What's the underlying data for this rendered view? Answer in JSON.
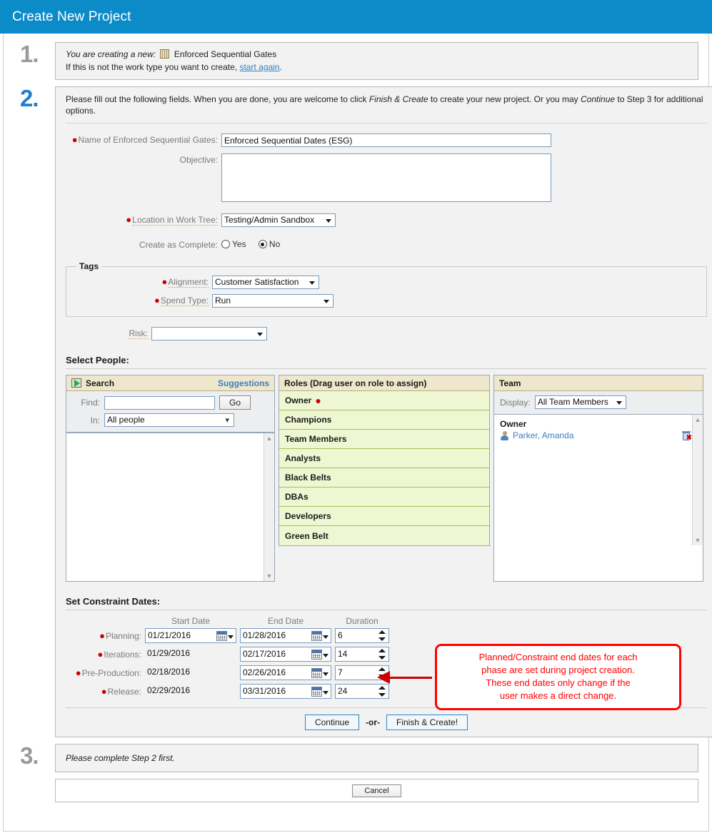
{
  "window": {
    "title": "Create New Project"
  },
  "step1": {
    "number": "1.",
    "lead": "You are creating a new:",
    "work_type": "Enforced Sequential Gates",
    "work_type_icon": "gates-icon",
    "line2_prefix": "If this is not the work type you want to create,",
    "restart_link": "start again",
    "line2_suffix": "."
  },
  "step2": {
    "number": "2.",
    "intro_part1": "Please fill out the following fields. When you are done, you are welcome to click ",
    "intro_em1": "Finish & Create",
    "intro_part2": " to create your new project. Or you may ",
    "intro_em2": "Continue",
    "intro_part3": " to Step 3 for additional options.",
    "fields": {
      "name_label": "Name of Enforced Sequential Gates:",
      "name_value": "Enforced Sequential Dates (ESG)",
      "objective_label": "Objective:",
      "objective_value": "",
      "location_label": "Location in Work Tree:",
      "location_value": "Testing/Admin Sandbox",
      "complete_label": "Create as Complete:",
      "complete_yes": "Yes",
      "complete_no": "No",
      "complete_selected": "No"
    },
    "tags": {
      "legend": "Tags",
      "alignment_label": "Alignment:",
      "alignment_value": "Customer Satisfaction",
      "spend_label": "Spend Type:",
      "spend_value": "Run"
    },
    "risk_label": "Risk:",
    "risk_value": "",
    "people": {
      "heading": "Select People:",
      "search": {
        "title": "Search",
        "icon": "search-icon",
        "suggestions_link": "Suggestions",
        "find_label": "Find:",
        "find_value": "",
        "go_label": "Go",
        "in_label": "In:",
        "in_value": "All people"
      },
      "roles": {
        "title": "Roles (Drag user on role to assign)",
        "items": [
          {
            "label": "Owner",
            "required": true
          },
          {
            "label": "Champions",
            "required": false
          },
          {
            "label": "Team Members",
            "required": false
          },
          {
            "label": "Analysts",
            "required": false
          },
          {
            "label": "Black Belts",
            "required": false
          },
          {
            "label": "DBAs",
            "required": false
          },
          {
            "label": "Developers",
            "required": false
          },
          {
            "label": "Green Belt",
            "required": false
          }
        ]
      },
      "team": {
        "title": "Team",
        "display_label": "Display:",
        "display_value": "All Team Members",
        "group_label": "Owner",
        "member_name": "Parker, Amanda",
        "member_avatar": "user-avatar-icon",
        "remove_icon": "trash-delete-icon"
      }
    },
    "dates": {
      "heading": "Set Constraint Dates:",
      "columns": [
        "Start Date",
        "End Date",
        "Duration"
      ],
      "rows": [
        {
          "label": "Planning:",
          "start": "01/21/2016",
          "start_editable": true,
          "end": "01/28/2016",
          "duration": "6"
        },
        {
          "label": "Iterations:",
          "start": "01/29/2016",
          "start_editable": false,
          "end": "02/17/2016",
          "duration": "14"
        },
        {
          "label": "Pre-Production:",
          "start": "02/18/2016",
          "start_editable": false,
          "end": "02/26/2016",
          "duration": "7"
        },
        {
          "label": "Release:",
          "start": "02/29/2016",
          "start_editable": false,
          "end": "03/31/2016",
          "duration": "24"
        }
      ]
    },
    "callout": {
      "line1": "Planned/Constraint end dates for each",
      "line2": "phase are set during project creation.",
      "line3": "These end dates only change if the",
      "line4": "user makes a direct change."
    },
    "actions": {
      "continue_label": "Continue",
      "or_label": "-or-",
      "finish_label": "Finish & Create!"
    }
  },
  "step3": {
    "number": "3.",
    "message": "Please complete Step 2 first."
  },
  "footer": {
    "cancel_label": "Cancel"
  },
  "colors": {
    "title_bar": "#0b8bc8",
    "step_active": "#1f7fd0",
    "step_inactive": "#9a9a9a",
    "required_dot": "#cc0000",
    "panel_header": "#eee7cc",
    "role_row": "#eef6d2",
    "callout_red": "#ff0000",
    "link": "#3c7fbf"
  }
}
